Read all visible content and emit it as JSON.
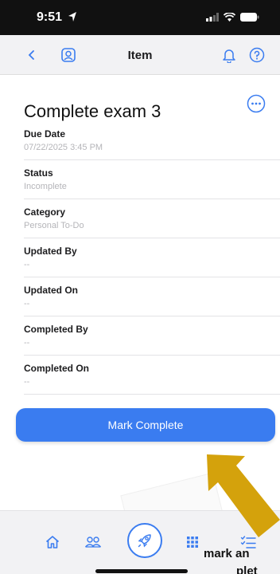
{
  "status_bar": {
    "time": "9:51"
  },
  "nav": {
    "title": "Item"
  },
  "item": {
    "title": "Complete exam 3",
    "fields": [
      {
        "label": "Due Date",
        "value": "07/22/2025 3:45 PM"
      },
      {
        "label": "Status",
        "value": "Incomplete"
      },
      {
        "label": "Category",
        "value": "Personal To-Do"
      },
      {
        "label": "Updated By",
        "value": "--"
      },
      {
        "label": "Updated On",
        "value": "--"
      },
      {
        "label": "Completed By",
        "value": "--"
      },
      {
        "label": "Completed On",
        "value": "--"
      }
    ]
  },
  "actions": {
    "mark_complete_label": "Mark Complete"
  },
  "tab_bar": {
    "items": [
      "home-icon",
      "people-icon",
      "rocket-icon",
      "grid-icon",
      "checklist-icon"
    ]
  },
  "annotation": {
    "line1": "mark an",
    "line2": "plet"
  },
  "colors": {
    "accent": "#3a7cf0",
    "arrow": "#d4a20c",
    "status_bar": "#111111"
  }
}
